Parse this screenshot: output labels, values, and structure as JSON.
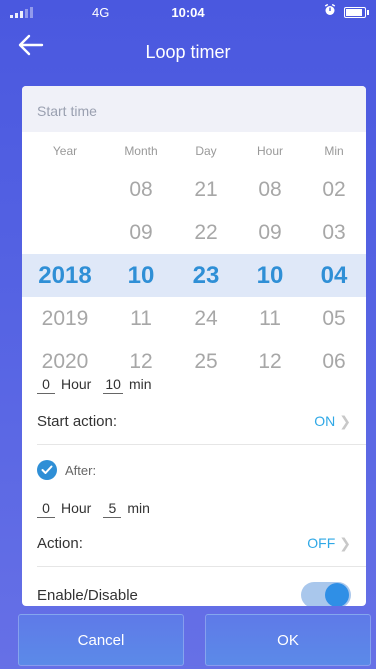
{
  "status_bar": {
    "carrier": "4G",
    "time": "10:04",
    "alarm_icon": "alarm-icon",
    "battery_icon": "battery-icon"
  },
  "header": {
    "title": "Loop timer",
    "back_icon": "arrow-left-icon"
  },
  "card": {
    "section_title": "Start time",
    "columns": [
      "Year",
      "Month",
      "Day",
      "Hour",
      "Min"
    ],
    "picker_rows": [
      [
        "",
        "08",
        "21",
        "08",
        "02"
      ],
      [
        "",
        "09",
        "22",
        "09",
        "03"
      ],
      [
        "2018",
        "10",
        "23",
        "10",
        "04"
      ],
      [
        "2019",
        "11",
        "24",
        "11",
        "05"
      ],
      [
        "2020",
        "12",
        "25",
        "12",
        "06"
      ]
    ],
    "selected_row_index": 2,
    "loop_duration": {
      "hour_value": "0",
      "hour_label": "Hour",
      "min_value": "10",
      "min_label": "min"
    },
    "start_action": {
      "label": "Start action:",
      "value": "ON"
    },
    "after": {
      "checked": true,
      "label": "After:"
    },
    "after_duration": {
      "hour_value": "0",
      "hour_label": "Hour",
      "min_value": "5",
      "min_label": "min"
    },
    "action": {
      "label": "Action:",
      "value": "OFF"
    },
    "enable": {
      "label": "Enable/Disable",
      "enabled": true
    }
  },
  "buttons": {
    "cancel": "Cancel",
    "ok": "OK"
  },
  "colors": {
    "accent": "#2f8fd6",
    "header_bg": "#4a58df",
    "selected_row_bg": "#dfe8f8"
  }
}
